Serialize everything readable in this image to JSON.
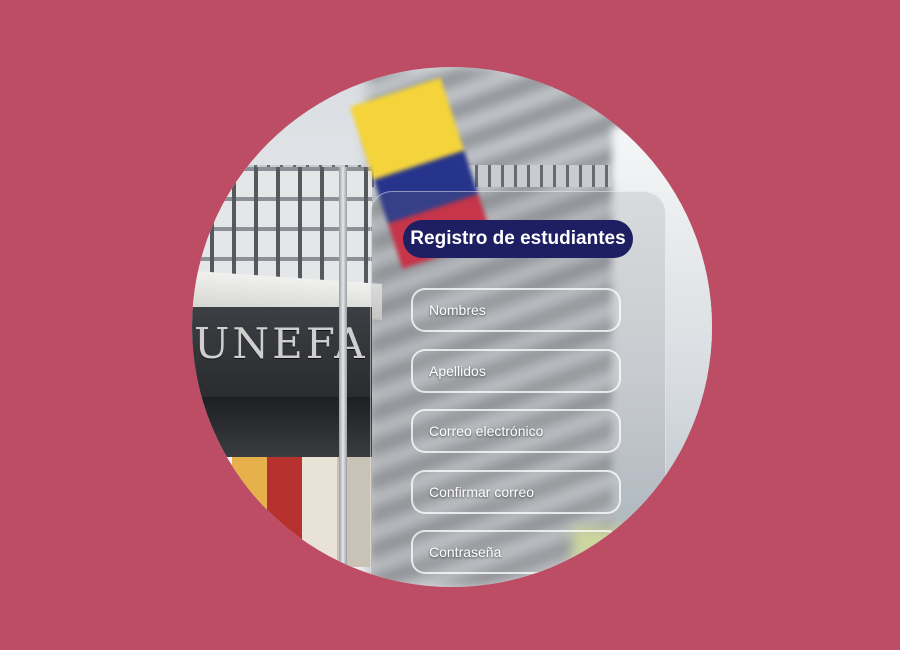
{
  "form": {
    "title": "Registro de estudiantes",
    "fields": [
      {
        "label": "Nombres"
      },
      {
        "label": "Apellidos"
      },
      {
        "label": "Correo electrónico"
      },
      {
        "label": "Confirmar correo"
      },
      {
        "label": "Contraseña"
      }
    ]
  },
  "background": {
    "building_sign": "UNEFA",
    "page_color": "#bd4d64",
    "title_color": "#1e1f63"
  }
}
